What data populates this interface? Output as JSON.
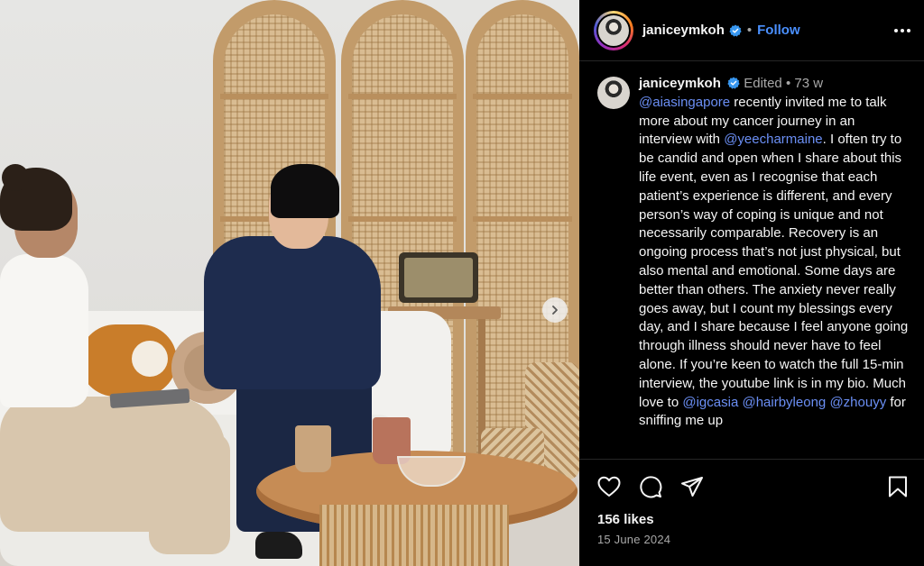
{
  "post": {
    "username": "janiceymkoh",
    "follow_label": "Follow",
    "header_separator": "•"
  },
  "caption": {
    "username": "janiceymkoh",
    "edited_label": "Edited",
    "meta_separator": "•",
    "age": "73 w",
    "segments": [
      {
        "type": "mention",
        "text": "@aiasingapore"
      },
      {
        "type": "text",
        "text": " recently invited me to talk more about my cancer journey in an interview with "
      },
      {
        "type": "mention",
        "text": "@yeecharmaine"
      },
      {
        "type": "text",
        "text": ". I often try to be candid and open when I share about this life event, even as I recognise that each patient’s experience is different, and every person’s way of coping is unique and not necessarily comparable. Recovery is an ongoing process that’s not just physical, but also mental and emotional. Some days are better than others. The anxiety never really goes away, but I count my blessings every day, and I share because I feel anyone going through illness should never have to feel alone. If you’re keen to watch the full 15-min interview, the youtube link is in my bio. Much love to "
      },
      {
        "type": "mention",
        "text": "@igcasia"
      },
      {
        "type": "text",
        "text": " "
      },
      {
        "type": "mention",
        "text": "@hairbyleong"
      },
      {
        "type": "text",
        "text": " "
      },
      {
        "type": "mention",
        "text": "@zhouyy"
      },
      {
        "type": "text",
        "text": " for sniffing me up"
      }
    ]
  },
  "stats": {
    "likes": "156 likes",
    "date": "15 June 2024"
  },
  "icons": {
    "verified": "verified-badge-icon",
    "more": "more-options-icon",
    "like": "heart-icon",
    "comment": "comment-icon",
    "share": "share-icon",
    "save": "bookmark-icon",
    "carousel_next": "chevron-right-icon"
  },
  "colors": {
    "background": "#000000",
    "text": "#f5f5f5",
    "muted": "#a8a8a8",
    "link": "#4a90ff",
    "mention": "#6b8ff5",
    "verified": "#3897f0"
  }
}
